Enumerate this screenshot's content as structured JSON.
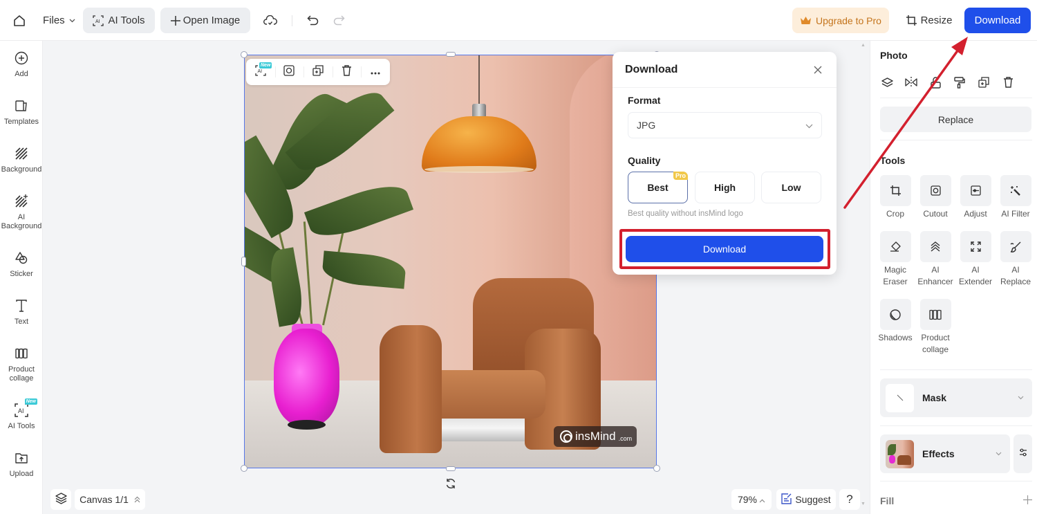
{
  "topbar": {
    "files_label": "Files",
    "ai_tools_label": "AI Tools",
    "open_image_label": "Open Image",
    "upgrade_label": "Upgrade to Pro",
    "resize_label": "Resize",
    "download_label": "Download"
  },
  "sidebar": {
    "items": [
      {
        "label": "Add",
        "icon": "plus-circle-icon"
      },
      {
        "label": "Templates",
        "icon": "templates-icon"
      },
      {
        "label": "Background",
        "icon": "background-icon"
      },
      {
        "label": "AI Background",
        "icon": "ai-background-icon"
      },
      {
        "label": "Sticker",
        "icon": "sticker-icon"
      },
      {
        "label": "Text",
        "icon": "text-icon"
      },
      {
        "label": "Product collage",
        "icon": "collage-icon"
      },
      {
        "label": "AI Tools",
        "icon": "ai-tools-icon",
        "badge": "New"
      },
      {
        "label": "Upload",
        "icon": "upload-icon"
      }
    ]
  },
  "canvas": {
    "context_toolbar": {
      "ai_badge": "New"
    },
    "watermark": {
      "brand": "insMind",
      "suffix": ".com"
    },
    "canvas_label": "Canvas 1/1",
    "zoom": "79%",
    "suggest_label": "Suggest",
    "help_label": "?"
  },
  "dialog": {
    "title": "Download",
    "format_label": "Format",
    "format_value": "JPG",
    "quality_label": "Quality",
    "quality_options": [
      {
        "label": "Best",
        "badge": "Pro",
        "selected": true
      },
      {
        "label": "High",
        "selected": false
      },
      {
        "label": "Low",
        "selected": false
      }
    ],
    "quality_hint": "Best quality without insMind logo",
    "download_button": "Download"
  },
  "right_panel": {
    "photo_title": "Photo",
    "photo_actions": [
      "layers-icon",
      "flip-icon",
      "unlock-icon",
      "paint-roller-icon",
      "duplicate-icon",
      "trash-icon"
    ],
    "replace_label": "Replace",
    "tools_title": "Tools",
    "tools": [
      {
        "label": "Crop",
        "icon": "crop-icon"
      },
      {
        "label": "Cutout",
        "icon": "cutout-icon"
      },
      {
        "label": "Adjust",
        "icon": "adjust-icon"
      },
      {
        "label": "AI Filter",
        "icon": "ai-filter-icon"
      },
      {
        "label": "Magic Eraser",
        "icon": "eraser-icon"
      },
      {
        "label": "AI Enhancer",
        "icon": "enhancer-icon"
      },
      {
        "label": "AI Extender",
        "icon": "extender-icon"
      },
      {
        "label": "AI Replace",
        "icon": "ai-replace-icon"
      },
      {
        "label": "Shadows",
        "icon": "shadows-icon"
      },
      {
        "label": "Product collage",
        "icon": "collage-icon"
      }
    ],
    "mask_label": "Mask",
    "effects_label": "Effects",
    "fill_label": "Fill"
  },
  "colors": {
    "accent": "#1f4fea",
    "upgrade_bg": "#fdeedb",
    "upgrade_text": "#c4741c",
    "highlight": "#d3202e",
    "pro_badge": "#f1c84a",
    "new_badge": "#3ccad7"
  }
}
